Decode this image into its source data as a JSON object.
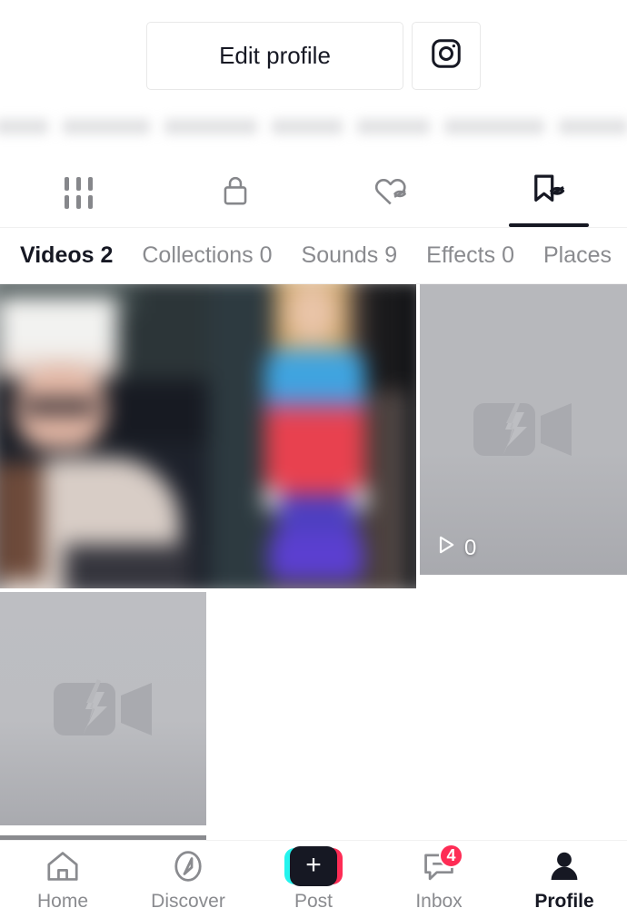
{
  "profile_actions": {
    "edit_profile_label": "Edit profile",
    "instagram_icon": "instagram-icon"
  },
  "bio": {
    "redacted": true,
    "word_widths": [
      58,
      96,
      102,
      78,
      80,
      110,
      76
    ],
    "trailing_char": "."
  },
  "icon_tabs": [
    {
      "name": "posts-grid-icon",
      "active": false
    },
    {
      "name": "lock-icon",
      "active": false
    },
    {
      "name": "heart-hidden-icon",
      "active": false
    },
    {
      "name": "bookmark-hidden-icon",
      "active": true
    }
  ],
  "sub_tabs": [
    {
      "label": "Videos 2",
      "active": true
    },
    {
      "label": "Collections 0",
      "active": false
    },
    {
      "label": "Sounds 9",
      "active": false
    },
    {
      "label": "Effects 0",
      "active": false
    },
    {
      "label": "Places",
      "active": false
    }
  ],
  "videos": [
    {
      "type": "photo",
      "play_count": ""
    },
    {
      "type": "broken",
      "play_count": "0"
    },
    {
      "type": "broken",
      "play_count": ""
    }
  ],
  "bottom_nav": [
    {
      "label": "Home",
      "icon": "home-icon",
      "active": false,
      "badge": ""
    },
    {
      "label": "Discover",
      "icon": "compass-icon",
      "active": false,
      "badge": ""
    },
    {
      "label": "Post",
      "icon": "post-plus-icon",
      "active": false,
      "badge": ""
    },
    {
      "label": "Inbox",
      "icon": "inbox-icon",
      "active": false,
      "badge": "4"
    },
    {
      "label": "Profile",
      "icon": "person-icon",
      "active": true,
      "badge": ""
    }
  ],
  "colors": {
    "accent_pink": "#fe2c55",
    "accent_cyan": "#25f4ee",
    "text_primary": "#161823",
    "text_secondary": "#8a8b8f"
  }
}
